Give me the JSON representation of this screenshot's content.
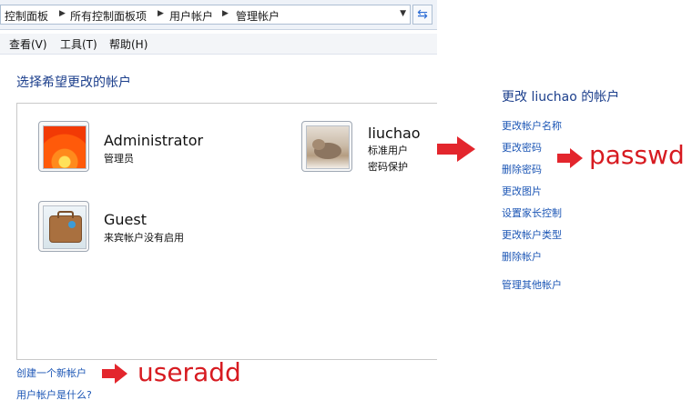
{
  "address_bar": {
    "crumbs": [
      "控制面板",
      "所有控制面板项",
      "用户帐户",
      "管理帐户"
    ]
  },
  "menu": [
    "查看(V)",
    "工具(T)",
    "帮助(H)"
  ],
  "main": {
    "heading": "选择希望更改的帐户",
    "accounts": [
      {
        "name": "Administrator",
        "lines": [
          "管理员"
        ]
      },
      {
        "name": "liuchao",
        "lines": [
          "标准用户",
          "密码保护"
        ]
      },
      {
        "name": "Guest",
        "lines": [
          "来宾帐户没有启用"
        ]
      }
    ],
    "create_link": "创建一个新帐户",
    "help_link": "用户帐户是什么?"
  },
  "side_panel": {
    "title": "更改 liuchao 的帐户",
    "links": [
      "更改帐户名称",
      "更改密码",
      "删除密码",
      "更改图片",
      "设置家长控制",
      "更改帐户类型",
      "删除帐户"
    ],
    "manage_link": "管理其他帐户"
  },
  "annotations": {
    "passwd": "passwd",
    "useradd": "useradd"
  },
  "colors": {
    "annotation": "#d71b21",
    "link": "#1c56b5",
    "heading": "#1c3f8c"
  }
}
